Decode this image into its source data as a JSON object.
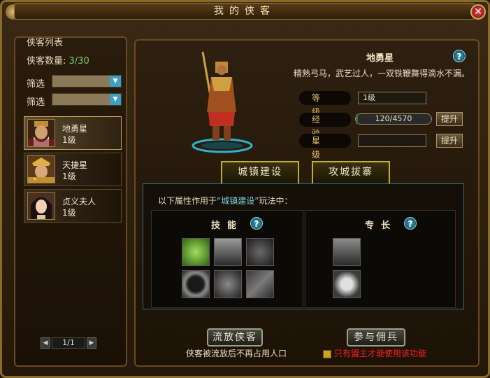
{
  "window": {
    "title": "我的侠客",
    "close_label": "✕"
  },
  "sidebar": {
    "title": "侠客列表",
    "count_label": "侠客数量:",
    "count_value": "3/30",
    "filters": [
      {
        "label": "筛选"
      },
      {
        "label": "筛选"
      }
    ],
    "heroes": [
      {
        "name": "地勇星",
        "level": "1级"
      },
      {
        "name": "天捷星",
        "level": "1级"
      },
      {
        "name": "贞义夫人",
        "level": "1级"
      }
    ],
    "pager": {
      "page": "1/1"
    }
  },
  "detail": {
    "name": "地勇星",
    "description": "精熟弓马，武艺过人，一双铁鞭舞得滴水不漏。",
    "level_label": "等级",
    "level_value": "1级",
    "exp_label": "经验",
    "exp_value": "120/4570",
    "exp_progress": 0.026,
    "star_label": "星级",
    "star_value": "",
    "upgrade_label": "提升",
    "star_upgrade_label": "提升",
    "tabs": [
      {
        "label": "城镇建设"
      },
      {
        "label": "攻城拔寨"
      }
    ],
    "scope_prefix": "以下属性作用于",
    "scope_highlight": "“城镇建设”",
    "scope_suffix": "玩法中：",
    "skills_title": "技能",
    "specialty_title": "专长",
    "release_button": "流放侠客",
    "release_note": "侠客被流放后不再占用人口",
    "mercenary_button": "参与佣兵",
    "mercenary_note": "只有盟主才能使用该功能"
  },
  "colors": {
    "highlight": "#80d0e0",
    "warning": "#ff2020",
    "count": "#7ad07a",
    "gold": "#e8c070"
  }
}
